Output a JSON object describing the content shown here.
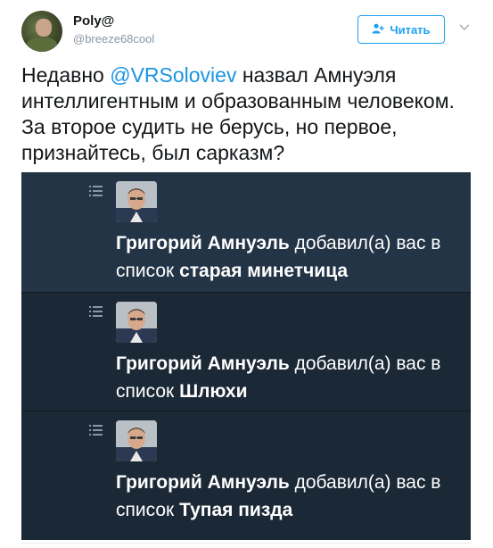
{
  "author": {
    "name": "Poly@",
    "handle": "@breeze68cool"
  },
  "follow_button": {
    "label": "Читать",
    "icon": "add-user-icon"
  },
  "more_menu": {
    "icon": "chevron-down-icon"
  },
  "tweet": {
    "text_before": "Недавно ",
    "mention": "@VRSoloviev",
    "text_after": " назвал Амнуэля интеллигентным и образованным человеком. За второе судить не берусь, но первое, признайтесь, был сарказм?"
  },
  "notifications": [
    {
      "icon": "list-icon",
      "actor": "Григорий Амнуэль",
      "action": "добавил(а) вас в список",
      "list_name": "старая минетчица"
    },
    {
      "icon": "list-icon",
      "actor": "Григорий Амнуэль",
      "action": "добавил(а) вас в список",
      "list_name": "Шлюхи"
    },
    {
      "icon": "list-icon",
      "actor": "Григорий Амнуэль",
      "action": "добавил(а) вас в список",
      "list_name": "Тупая пизда"
    }
  ],
  "colors": {
    "accent": "#1da1f2",
    "mention": "#1b95e0",
    "text": "#14171a",
    "muted": "#8899a6",
    "notif_bg": "#1b2836",
    "notif_bg_highlight": "#243447"
  }
}
